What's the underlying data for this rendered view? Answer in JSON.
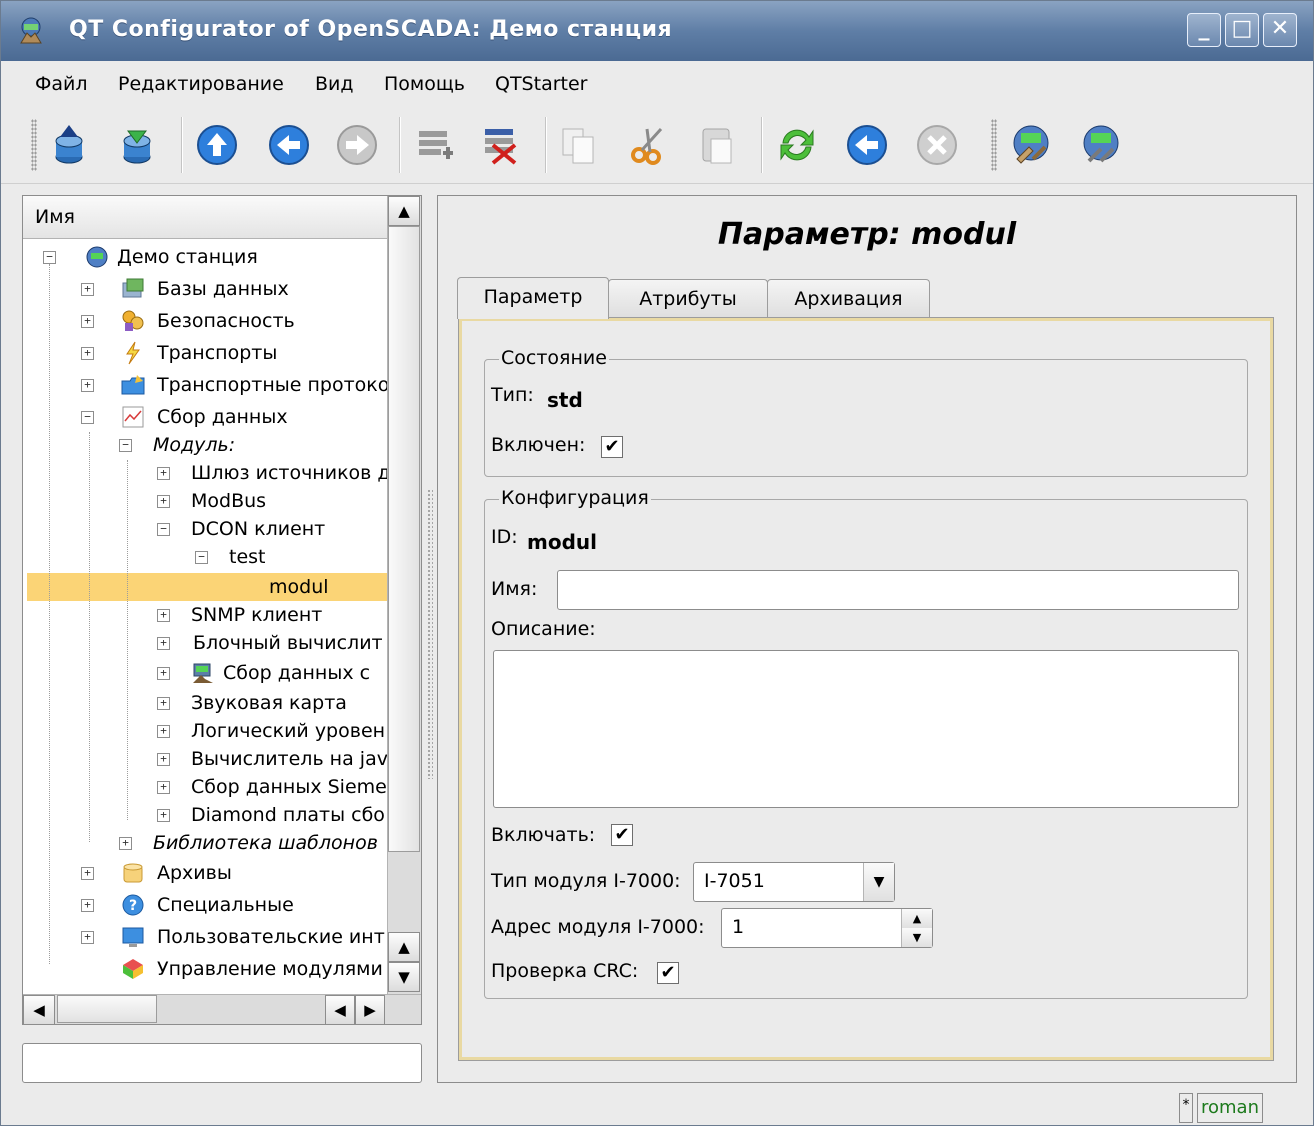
{
  "window": {
    "title": "QT Configurator of OpenSCADA: Демо станция"
  },
  "menu": {
    "file": "Файл",
    "edit": "Редактирование",
    "view": "Вид",
    "help": "Помощь",
    "qtstarter": "QTStarter"
  },
  "tree": {
    "header": "Имя",
    "items": [
      {
        "label": "Демо станция"
      },
      {
        "label": "Базы данных"
      },
      {
        "label": "Безопасность"
      },
      {
        "label": "Транспорты"
      },
      {
        "label": "Транспортные протоко"
      },
      {
        "label": "Сбор данных"
      },
      {
        "label": "Модуль:"
      },
      {
        "label": "Шлюз источников д"
      },
      {
        "label": "ModBus"
      },
      {
        "label": "DCON клиент"
      },
      {
        "label": "test"
      },
      {
        "label": "modul"
      },
      {
        "label": "SNMP клиент"
      },
      {
        "label": "Блочный вычислит"
      },
      {
        "label": "Сбор данных с"
      },
      {
        "label": "Звуковая карта"
      },
      {
        "label": "Логический уровен"
      },
      {
        "label": "Вычислитель на jav"
      },
      {
        "label": "Сбор данных Sieme"
      },
      {
        "label": "Diamond платы сбо"
      },
      {
        "label": "Библиотека шаблонов"
      },
      {
        "label": "Архивы"
      },
      {
        "label": "Специальные"
      },
      {
        "label": "Пользовательские инт"
      },
      {
        "label": "Управление модулями"
      }
    ]
  },
  "panel": {
    "title": "Параметр: modul",
    "tabs": [
      "Параметр",
      "Атрибуты",
      "Архивация"
    ],
    "state": {
      "group": "Состояние",
      "type_label": "Тип:",
      "type_value": "std",
      "enabled_label": "Включен:",
      "enabled": true
    },
    "config": {
      "group": "Конфигурация",
      "id_label": "ID:",
      "id_value": "modul",
      "name_label": "Имя:",
      "name_value": "",
      "descr_label": "Описание:",
      "descr_value": "",
      "enable_label": "Включать:",
      "enable": true,
      "module_type_label": "Тип модуля I-7000:",
      "module_type_value": "I-7051",
      "module_addr_label": "Адрес модуля I-7000:",
      "module_addr_value": "1",
      "crc_label": "Проверка CRC:",
      "crc": true
    }
  },
  "statusbar": {
    "modified": "*",
    "user": "roman"
  },
  "colors": {
    "selection": "#fbd476",
    "tab_frame": "#e9d9a2",
    "user": "#1d7a1d"
  }
}
